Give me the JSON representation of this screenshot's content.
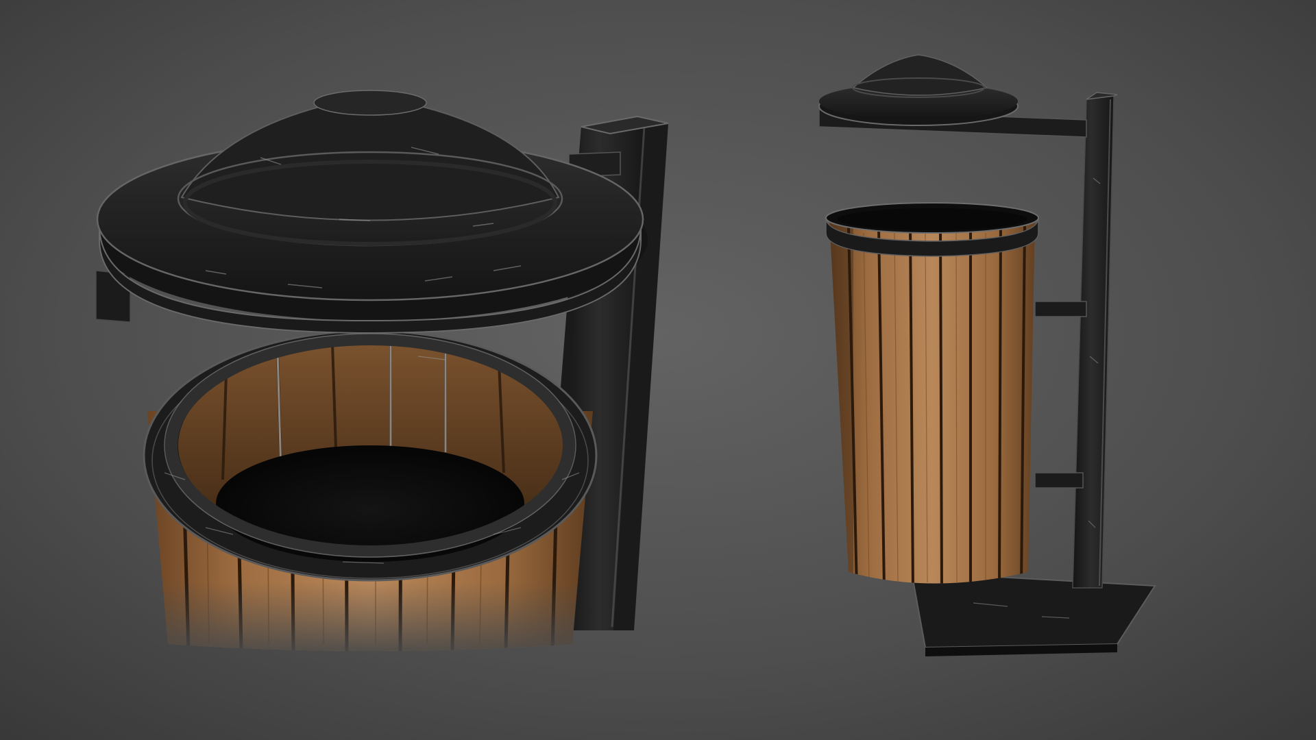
{
  "scene": {
    "subject": "wooden-slat-trash-bin-with-metal-lid",
    "views": [
      "closeup-view",
      "full-view"
    ],
    "colors": {
      "background_center": "#606060",
      "background_edge": "#3a3a3a",
      "metal": "#1c1c1c",
      "metal_highlight": "#8a8a8a",
      "wood": "#9a6a3e",
      "wood_light": "#b98a5c",
      "wood_dark": "#5e3c1f"
    }
  }
}
